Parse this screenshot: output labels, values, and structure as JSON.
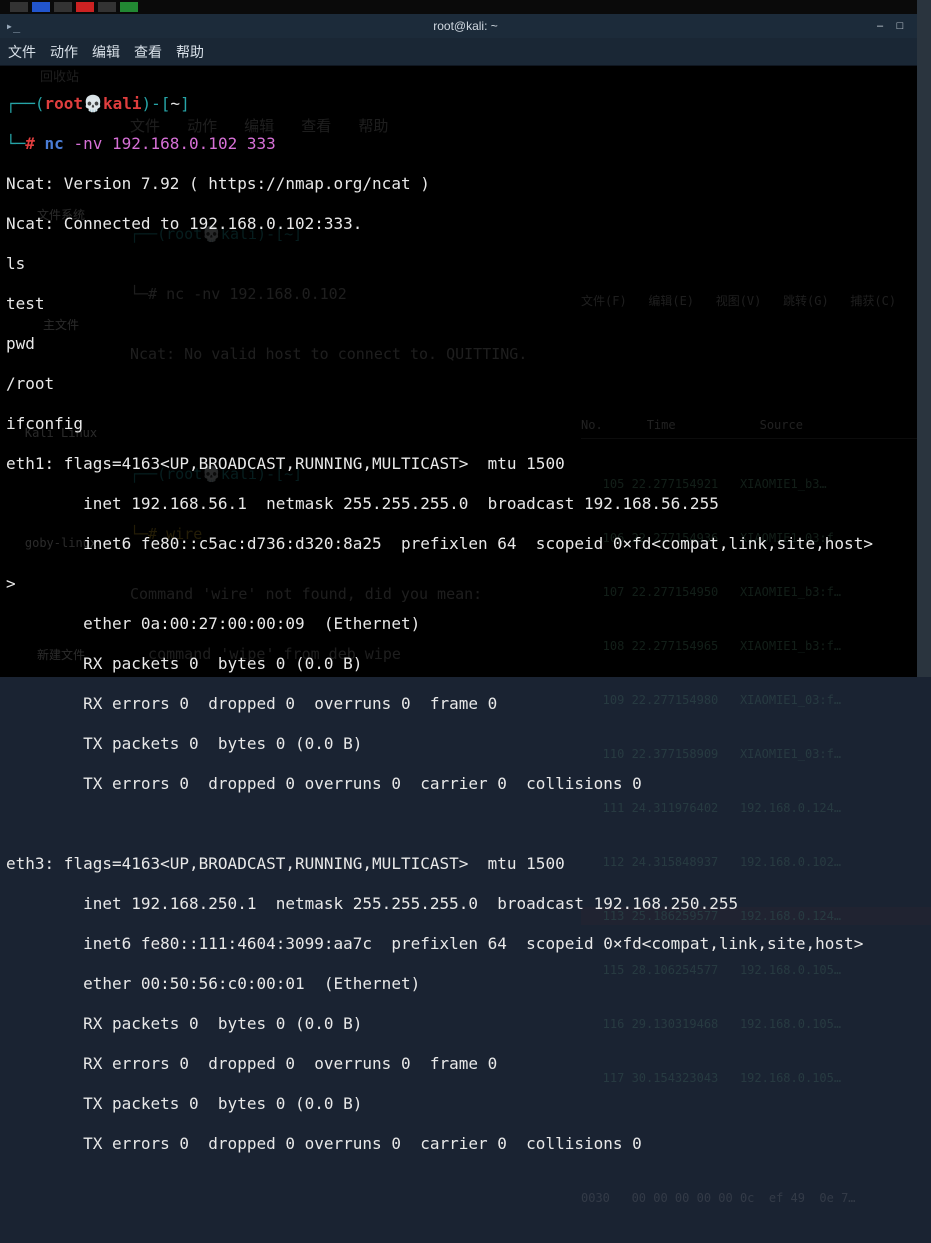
{
  "taskbar": {},
  "window": {
    "title": "root@kali: ~",
    "controls": {
      "min": "–",
      "max": "□",
      "close": "×"
    }
  },
  "menubar": {
    "items": [
      "文件",
      "动作",
      "编辑",
      "查看",
      "帮助"
    ]
  },
  "prompt": {
    "open": "┌──(",
    "user": "root",
    "host": "kali",
    "at_open": ")-[",
    "cwd": "~",
    "close": "]",
    "line2": "└─",
    "hash": "#",
    "skull": "💀"
  },
  "cmd": {
    "nc": "nc",
    "args": " -nv 192.168.0.102 333"
  },
  "out": {
    "l0": "Ncat: Version 7.92 ( https://nmap.org/ncat )",
    "l1": "Ncat: Connected to 192.168.0.102:333.",
    "l2": "ls",
    "l3": "test",
    "l4": "pwd",
    "l5": "/root",
    "l6": "ifconfig",
    "l7": "eth1: flags=4163<UP,BROADCAST,RUNNING,MULTICAST>  mtu 1500",
    "l8": "        inet 192.168.56.1  netmask 255.255.255.0  broadcast 192.168.56.255",
    "l9": "        inet6 fe80::c5ac:d736:d320:8a25  prefixlen 64  scopeid 0×fd<compat,link,site,host>",
    "l10": "",
    "l11": "        ether 0a:00:27:00:00:09  (Ethernet)",
    "l12": "        RX packets 0  bytes 0 (0.0 B)",
    "l13": "        RX errors 0  dropped 0  overruns 0  frame 0",
    "l14": "        TX packets 0  bytes 0 (0.0 B)",
    "l15": "        TX errors 0  dropped 0 overruns 0  carrier 0  collisions 0",
    "l16": "",
    "l17": "eth3: flags=4163<UP,BROADCAST,RUNNING,MULTICAST>  mtu 1500",
    "l18": "        inet 192.168.250.1  netmask 255.255.255.0  broadcast 192.168.250.255",
    "l19": "        inet6 fe80::111:4604:3099:aa7c  prefixlen 64  scopeid 0×fd<compat,link,site,host>",
    "l20": "        ether 00:50:56:c0:00:01  (Ethernet)",
    "l21": "        RX packets 0  bytes 0 (0.0 B)",
    "l22": "        RX errors 0  dropped 0  overruns 0  frame 0",
    "l23": "        TX packets 0  bytes 0 (0.0 B)",
    "l24": "        TX errors 0  dropped 0 overruns 0  carrier 0  collisions 0",
    "prompt_gt": ">"
  },
  "bg": {
    "recycle": "回收站",
    "menubar2": "文件   动作   编辑   查看   帮助",
    "bgprompt1": "┌──(root💀kali)-[~]",
    "bgprompt2": "└─# nc -nv 192.168.0.102",
    "bgncat": "Ncat: No valid host to connect to. QUITTING.",
    "bgprompt3": "┌──(root💀kali)-[~]",
    "bgprompt4": "└─# wire",
    "bgerr1": "Command 'wire' not found, did you mean:",
    "bgerr2": "  command 'wipe' from deb wipe",
    "fs": "文件系统",
    "home": "主文件",
    "kali": "Kali Linux",
    "goby": "goby-linux",
    "newfile": "新建文件",
    "wireshark": {
      "menus": "文件(F)   编辑(E)   视图(V)   跳转(G)   捕获(C)",
      "cols": {
        "no": "No.",
        "time": "Time",
        "src": "Source"
      },
      "rows": [
        "   105 22.277154921   XIAOMIE1_b3…",
        "   106 22.277154936   XIAOMIE1_03:f…",
        "   107 22.277154950   XIAOMIE1_b3:f…",
        "   108 22.277154965   XIAOMIE1_b3:f…",
        "   109 22.277154980   XIAOMIE1_03:f…",
        "   110 22.377158909   XIAOMIE1_03:f…",
        "   111 24.311976402   192.168.0.124…",
        "   112 24.315848937   192.168.0.102…",
        "   113 25.186259577   192.168.0.124…",
        "   115 28.106254577   192.168.0.105…",
        "   116 29.130319468   192.168.0.105…",
        "   117 30.154323043   192.168.0.105…"
      ],
      "hex": "0030   00 00 00 00 00 0c  ef 49  0e 7…"
    }
  }
}
